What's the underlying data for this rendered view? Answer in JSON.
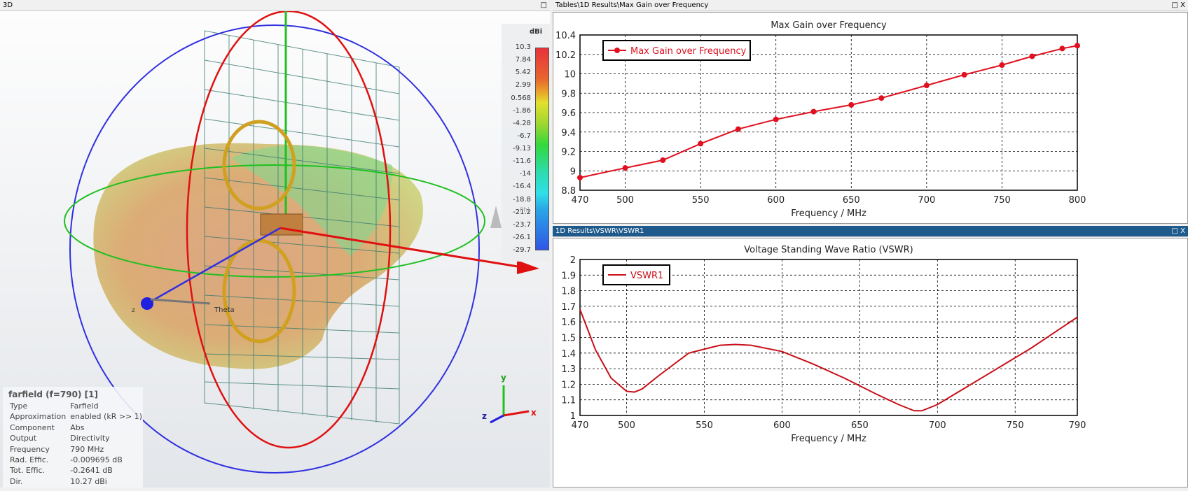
{
  "view3d": {
    "header": "3D",
    "colorbar": {
      "unit": "dBi",
      "labels": [
        "10.3",
        "7.84",
        "5.42",
        "2.99",
        "0.568",
        "-1.86",
        "-4.28",
        "-6.7",
        "-9.13",
        "-11.6",
        "-14",
        "-16.4",
        "-18.8",
        "-21.2",
        "-23.7",
        "-26.1",
        "-29.7"
      ]
    },
    "axis_labels": {
      "theta": "Theta",
      "phi": "Phi",
      "z": "z",
      "x": "x",
      "y": "y"
    },
    "info": {
      "title": "farfield (f=790) [1]",
      "rows": [
        [
          "Type",
          "Farfield"
        ],
        [
          "Approximation",
          "enabled (kR >> 1)"
        ],
        [
          "Component",
          "Abs"
        ],
        [
          "Output",
          "Directivity"
        ],
        [
          "Frequency",
          "790 MHz"
        ],
        [
          "Rad. Effic.",
          "-0.009695 dB"
        ],
        [
          "Tot. Effic.",
          "-0.2641 dB"
        ],
        [
          "Dir.",
          "10.27 dBi"
        ]
      ]
    }
  },
  "gain_panel": {
    "header": "Tables\\1D Results\\Max Gain over Frequency",
    "buttons": "□ X"
  },
  "vswr_panel": {
    "header": "1D Results\\VSWR\\VSWR1",
    "buttons": "□ X"
  },
  "chart_data": [
    {
      "type": "line",
      "title": "Max Gain over Frequency",
      "xlabel": "Frequency / MHz",
      "ylabel": "",
      "legend": "Max Gain over Frequency",
      "legend_position": "top-left",
      "color": "#e01020",
      "markers": true,
      "grid": true,
      "xlim": [
        470,
        800
      ],
      "ylim": [
        8.8,
        10.4
      ],
      "xticks": [
        470,
        500,
        550,
        600,
        650,
        700,
        750,
        800
      ],
      "yticks": [
        8.8,
        9,
        9.2,
        9.4,
        9.6,
        9.8,
        10,
        10.2,
        10.4
      ],
      "x": [
        470,
        500,
        525,
        550,
        575,
        600,
        625,
        650,
        670,
        700,
        725,
        750,
        770,
        790,
        800
      ],
      "y": [
        8.93,
        9.03,
        9.11,
        9.28,
        9.43,
        9.53,
        9.61,
        9.68,
        9.75,
        9.88,
        9.99,
        10.09,
        10.18,
        10.26,
        10.29
      ]
    },
    {
      "type": "line",
      "title": "Voltage Standing Wave Ratio (VSWR)",
      "xlabel": "Frequency / MHz",
      "ylabel": "",
      "legend": "VSWR1",
      "legend_position": "top-left",
      "color": "#c81018",
      "markers": false,
      "grid": true,
      "xlim": [
        470,
        790
      ],
      "ylim": [
        1,
        2
      ],
      "xticks": [
        470,
        500,
        550,
        600,
        650,
        700,
        750,
        790
      ],
      "yticks": [
        1,
        1.1,
        1.2,
        1.3,
        1.4,
        1.5,
        1.6,
        1.7,
        1.8,
        1.9,
        2
      ],
      "x": [
        470,
        480,
        490,
        500,
        505,
        510,
        520,
        540,
        560,
        570,
        580,
        600,
        620,
        640,
        660,
        675,
        685,
        690,
        700,
        720,
        740,
        760,
        775,
        790
      ],
      "y": [
        1.68,
        1.42,
        1.24,
        1.155,
        1.15,
        1.17,
        1.25,
        1.4,
        1.45,
        1.455,
        1.45,
        1.41,
        1.33,
        1.24,
        1.14,
        1.07,
        1.03,
        1.03,
        1.07,
        1.19,
        1.31,
        1.43,
        1.53,
        1.63
      ]
    }
  ]
}
